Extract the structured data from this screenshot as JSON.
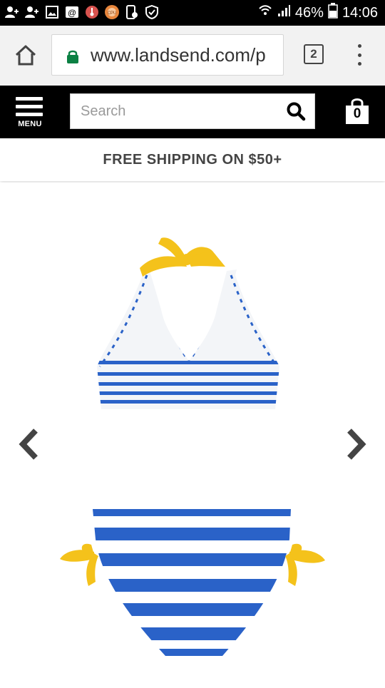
{
  "status_bar": {
    "battery": "46%",
    "time": "14:06"
  },
  "browser": {
    "url": "www.landsend.com/p",
    "tab_count": "2"
  },
  "header": {
    "menu_label": "MENU",
    "search_placeholder": "Search",
    "cart_count": "0"
  },
  "promo": {
    "text": "FREE SHIPPING ON $50+"
  },
  "colors": {
    "stripe_blue": "#2a62c8",
    "tie_yellow": "#f4c21b",
    "secure_green": "#0b8043"
  }
}
